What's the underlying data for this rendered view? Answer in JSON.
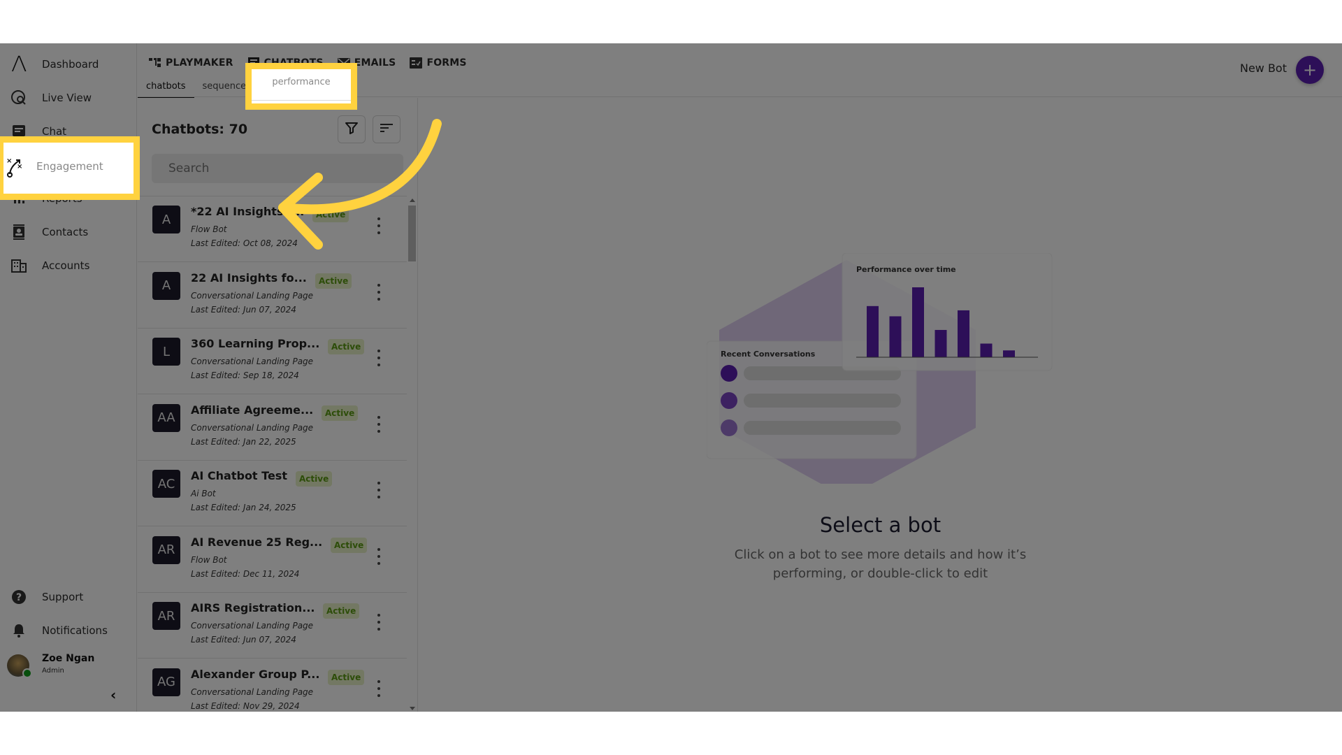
{
  "sidebar": {
    "items": [
      {
        "label": "Dashboard",
        "icon": "logo-icon"
      },
      {
        "label": "Live View",
        "icon": "live-view-icon"
      },
      {
        "label": "Chat",
        "icon": "chat-icon"
      },
      {
        "label": "Engagement",
        "icon": "engagement-icon",
        "highlighted": true
      },
      {
        "label": "Reports",
        "icon": "reports-icon"
      },
      {
        "label": "Contacts",
        "icon": "contacts-icon"
      },
      {
        "label": "Accounts",
        "icon": "accounts-icon"
      }
    ],
    "bottom_items": [
      {
        "label": "Support",
        "icon": "help-icon"
      },
      {
        "label": "Notifications",
        "icon": "bell-icon"
      }
    ],
    "user": {
      "name": "Zoe Ngan",
      "role": "Admin",
      "status": "online"
    },
    "collapse_label": "‹"
  },
  "topbar": {
    "tabs": [
      {
        "label": "PLAYMAKER",
        "icon": "playmaker-icon"
      },
      {
        "label": "CHATBOTS",
        "icon": "chatbots-icon"
      },
      {
        "label": "EMAILS",
        "icon": "emails-icon"
      },
      {
        "label": "FORMS",
        "icon": "forms-icon"
      }
    ],
    "sub_tabs": [
      {
        "label": "chatbots",
        "active": true
      },
      {
        "label": "sequences",
        "active": false
      },
      {
        "label": "performance",
        "active": false,
        "highlighted": true
      }
    ],
    "new_bot_label": "New Bot",
    "new_bot_icon": "+"
  },
  "list": {
    "title": "Chatbots: 70",
    "search_placeholder": "Search",
    "items": [
      {
        "initials": "A",
        "name": "*22 AI Insights f...",
        "status": "Active",
        "type": "Flow Bot",
        "edited": "Last Edited: Oct 08, 2024"
      },
      {
        "initials": "A",
        "name": "22 AI Insights fo...",
        "status": "Active",
        "type": "Conversational Landing Page",
        "edited": "Last Edited: Jun 07, 2024"
      },
      {
        "initials": "L",
        "name": "360 Learning Prop...",
        "status": "Active",
        "type": "Conversational Landing Page",
        "edited": "Last Edited: Sep 18, 2024"
      },
      {
        "initials": "AA",
        "name": "Affiliate Agreeme...",
        "status": "Active",
        "type": "Conversational Landing Page",
        "edited": "Last Edited: Jan 22, 2025"
      },
      {
        "initials": "AC",
        "name": "AI Chatbot Test",
        "status": "Active",
        "type": "Ai Bot",
        "edited": "Last Edited: Jan 24, 2025"
      },
      {
        "initials": "AR",
        "name": "AI Revenue 25 Reg...",
        "status": "Active",
        "type": "Flow Bot",
        "edited": "Last Edited: Dec 11, 2024"
      },
      {
        "initials": "AR",
        "name": "AIRS Registration...",
        "status": "Active",
        "type": "Conversational Landing Page",
        "edited": "Last Edited: Jun 07, 2024"
      },
      {
        "initials": "AG",
        "name": "Alexander Group P...",
        "status": "Active",
        "type": "Conversational Landing Page",
        "edited": "Last Edited: Nov 29, 2024"
      }
    ]
  },
  "main": {
    "illustration": {
      "chart_title": "Performance over time",
      "chart_bar_values": [
        60,
        48,
        82,
        32,
        55,
        16,
        8
      ],
      "conversations_title": "Recent Conversations",
      "conversation_count": 3
    },
    "empty_title": "Select a bot",
    "empty_desc_line1": "Click on a bot to see more details and how it’s",
    "empty_desc_line2": "performing, or double-click to edit"
  },
  "colors": {
    "accent": "#5b1fb0",
    "highlight": "#ffd23f",
    "active_badge_bg": "#e6f0c7",
    "active_badge_text": "#5a9a13",
    "overlay": "rgba(0,0,0,0.5)"
  }
}
